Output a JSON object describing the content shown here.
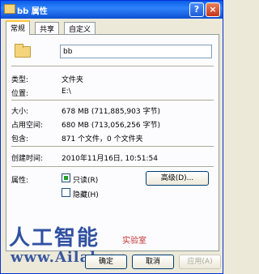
{
  "window": {
    "title": "bb 属性",
    "help": "?",
    "close": "×"
  },
  "tabs": [
    {
      "label": "常规"
    },
    {
      "label": "共享"
    },
    {
      "label": "自定义"
    }
  ],
  "general": {
    "name_value": "bb",
    "rows": [
      {
        "label": "类型:",
        "value": "文件夹"
      },
      {
        "label": "位置:",
        "value": "E:\\"
      },
      {
        "label": "大小:",
        "value": "678 MB (711,885,903 字节)"
      },
      {
        "label": "占用空间:",
        "value": "680 MB (713,056,256 字节)"
      },
      {
        "label": "包含:",
        "value": "871 个文件，0 个文件夹"
      },
      {
        "label": "创建时间:",
        "value": "2010年11月16日, 10:51:54"
      }
    ],
    "attributes_label": "属性:",
    "readonly_label": "只读(R)",
    "hidden_label": "隐藏(H)",
    "advanced_button": "高级(D)..."
  },
  "buttons": {
    "ok": "确定",
    "cancel": "取消",
    "apply": "应用(A)"
  },
  "watermark": {
    "line1": "人工智能",
    "line1_suffix": "实验室",
    "line2": "www.Ailab.cn"
  }
}
